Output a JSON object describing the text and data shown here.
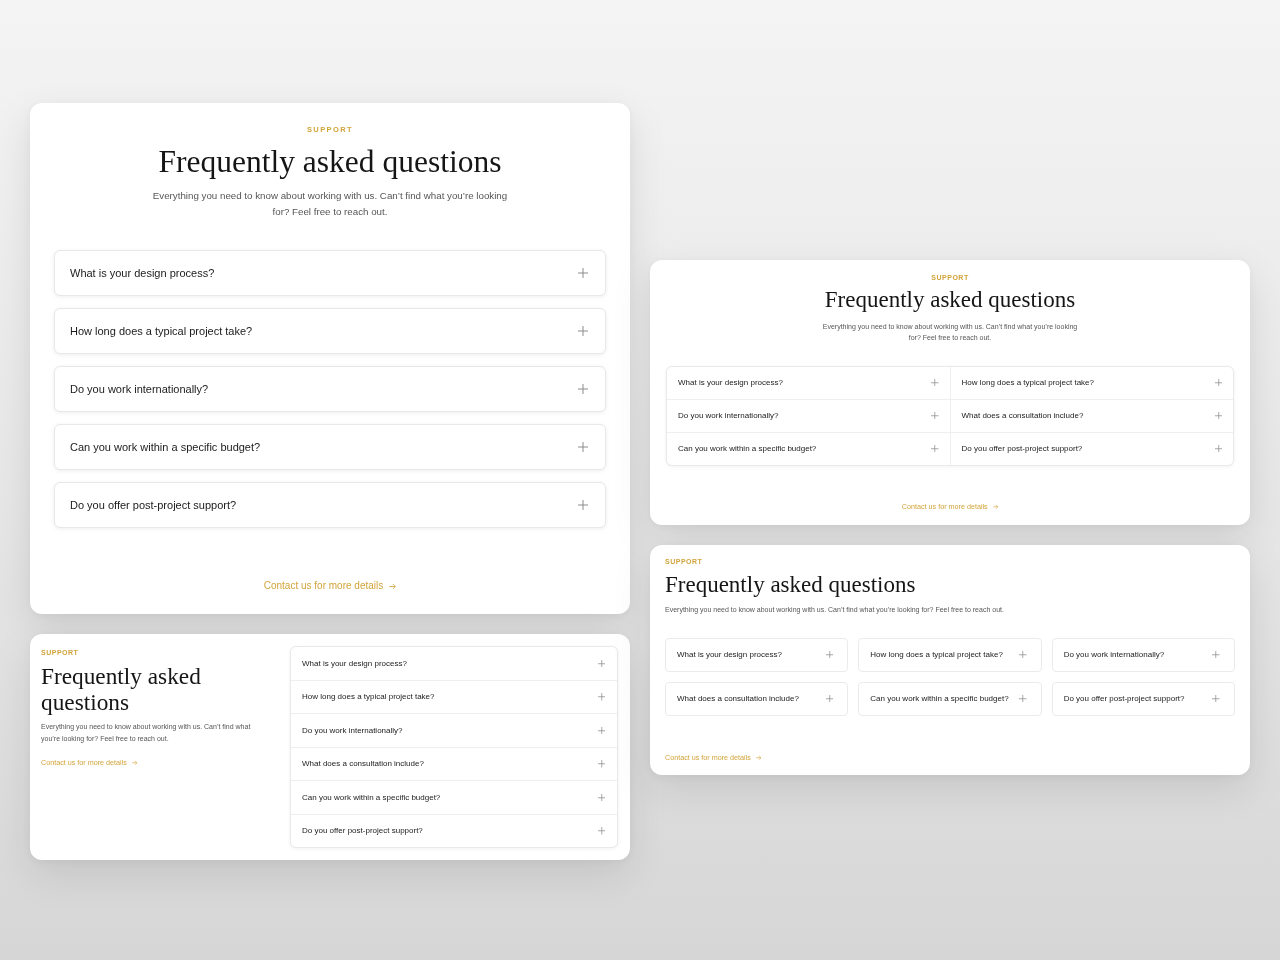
{
  "columns": [
    {
      "cards": [
        {
          "kind": "stacked",
          "eyebrow": "SUPPORT",
          "title": "Frequently asked questions",
          "description": "Everything you need to know about working with us. Can’t find what you’re looking for? Feel free to reach out.",
          "questions": [
            {
              "text": "What is your design process?",
              "expanded": false
            },
            {
              "text": "How long does a typical project take?",
              "expanded": false
            },
            {
              "text": "Do you work internationally?",
              "expanded": false
            },
            {
              "text": "Can you work within a specific budget?",
              "expanded": false
            },
            {
              "text": "Do you offer post-project support?",
              "expanded": false
            }
          ],
          "link": "Contact us for more details"
        },
        {
          "kind": "split",
          "eyebrow": "SUPPORT",
          "title": "Frequently asked questions",
          "description": "Everything you need to know about working with us. Can’t find what you’re looking for? Feel free to reach out.",
          "questions": [
            {
              "text": "What is your design process?",
              "expanded": false
            },
            {
              "text": "How long does a typical project take?",
              "expanded": false
            },
            {
              "text": "Do you work internationally?",
              "expanded": false
            },
            {
              "text": "What does a consultation include?",
              "expanded": false
            },
            {
              "text": "Can you work within a specific budget?",
              "expanded": false
            },
            {
              "text": "Do you offer post-project support?",
              "expanded": false
            }
          ],
          "link": "Contact us for more details"
        }
      ]
    },
    {
      "cards": [
        {
          "kind": "grid-2",
          "eyebrow": "SUPPORT",
          "title": "Frequently asked questions",
          "description": "Everything you need to know about working with us. Can’t find what you’re looking for? Feel free to reach out.",
          "questions": [
            {
              "text": "What is your design process?",
              "expanded": false
            },
            {
              "text": "How long does a typical project take?",
              "expanded": false
            },
            {
              "text": "Do you work internationally?",
              "expanded": false
            },
            {
              "text": "What does a consultation include?",
              "expanded": false
            },
            {
              "text": "Can you work within a specific budget?",
              "expanded": false
            },
            {
              "text": "Do you offer post-project support?",
              "expanded": false
            }
          ],
          "link": "Contact us for more details"
        },
        {
          "kind": "grid-3",
          "eyebrow": "SUPPORT",
          "title": "Frequently asked questions",
          "description": "Everything you need to know about working with us. Can’t find what you’re looking for? Feel free to reach out.",
          "questions": [
            {
              "text": "What is your design process?",
              "expanded": false
            },
            {
              "text": "How long does a typical project take?",
              "expanded": false
            },
            {
              "text": "Do you work internationally?",
              "expanded": false
            },
            {
              "text": "What does a consultation include?",
              "expanded": false
            },
            {
              "text": "Can you work within a specific budget?",
              "expanded": false
            },
            {
              "text": "Do you offer post-project support?",
              "expanded": false
            }
          ],
          "link": "Contact us for more details"
        }
      ]
    }
  ]
}
